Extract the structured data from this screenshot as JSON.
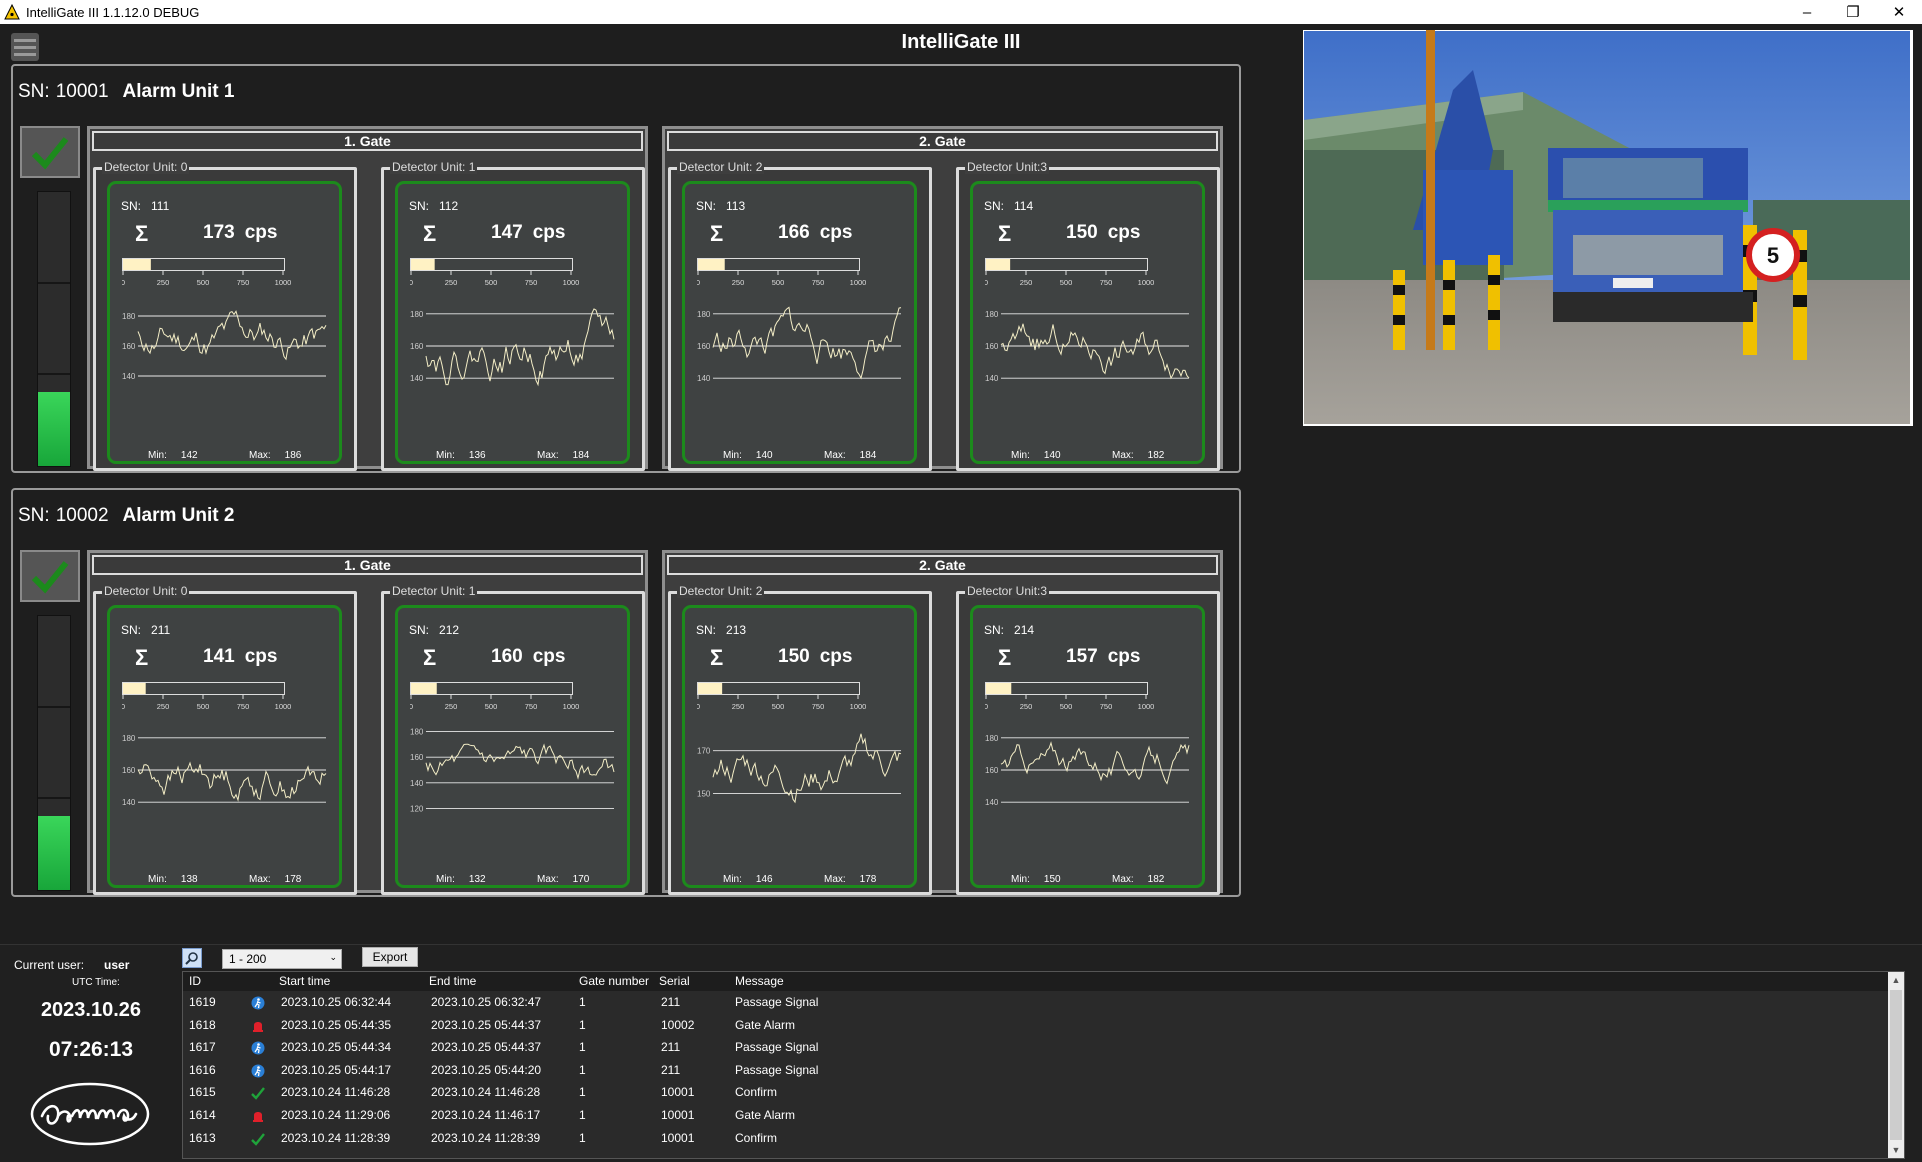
{
  "window": {
    "title": "IntelliGate III 1.1.12.0  DEBUG"
  },
  "app": {
    "title": "IntelliGate III"
  },
  "units": [
    {
      "sn_label": "SN:",
      "sn": "10001",
      "name": "Alarm Unit 1",
      "level": 0.27,
      "gates": [
        {
          "title": "1. Gate",
          "detectors": [
            {
              "label": "Detector Unit: 0",
              "sn_label": "SN:",
              "sn": "111",
              "sigma": "Σ",
              "cps": "173",
              "cps_unit": "cps",
              "fill": 0.173,
              "ticks": [
                "0",
                "250",
                "500",
                "750",
                "1000"
              ],
              "y_labels": [
                "180",
                "160",
                "140"
              ],
              "ylim": [
                130,
                190
              ],
              "min_label": "Min:",
              "min": "142",
              "max_label": "Max:",
              "max": "186",
              "seed": 11
            },
            {
              "label": "Detector Unit: 1",
              "sn_label": "SN:",
              "sn": "112",
              "sigma": "Σ",
              "cps": "147",
              "cps_unit": "cps",
              "fill": 0.147,
              "ticks": [
                "0",
                "250",
                "500",
                "750",
                "1000"
              ],
              "y_labels": [
                "180",
                "160",
                "140"
              ],
              "ylim": [
                132,
                188
              ],
              "min_label": "Min:",
              "min": "136",
              "max_label": "Max:",
              "max": "184",
              "seed": 22
            }
          ]
        },
        {
          "title": "2. Gate",
          "detectors": [
            {
              "label": "Detector Unit: 2",
              "sn_label": "SN:",
              "sn": "113",
              "sigma": "Σ",
              "cps": "166",
              "cps_unit": "cps",
              "fill": 0.166,
              "ticks": [
                "0",
                "250",
                "500",
                "750",
                "1000"
              ],
              "y_labels": [
                "180",
                "160",
                "140"
              ],
              "ylim": [
                132,
                188
              ],
              "min_label": "Min:",
              "min": "140",
              "max_label": "Max:",
              "max": "184",
              "seed": 33
            },
            {
              "label": "Detector Unit:3",
              "sn_label": "SN:",
              "sn": "114",
              "sigma": "Σ",
              "cps": "150",
              "cps_unit": "cps",
              "fill": 0.15,
              "ticks": [
                "0",
                "250",
                "500",
                "750",
                "1000"
              ],
              "y_labels": [
                "180",
                "160",
                "140"
              ],
              "ylim": [
                132,
                188
              ],
              "min_label": "Min:",
              "min": "140",
              "max_label": "Max:",
              "max": "182",
              "seed": 44
            }
          ]
        }
      ]
    },
    {
      "sn_label": "SN:",
      "sn": "10002",
      "name": "Alarm Unit 2",
      "level": 0.27,
      "gates": [
        {
          "title": "1. Gate",
          "detectors": [
            {
              "label": "Detector Unit: 0",
              "sn_label": "SN:",
              "sn": "211",
              "sigma": "Σ",
              "cps": "141",
              "cps_unit": "cps",
              "fill": 0.141,
              "ticks": [
                "0",
                "250",
                "500",
                "750",
                "1000"
              ],
              "y_labels": [
                "180",
                "160",
                "140"
              ],
              "ylim": [
                132,
                188
              ],
              "min_label": "Min:",
              "min": "138",
              "max_label": "Max:",
              "max": "178",
              "seed": 55
            },
            {
              "label": "Detector Unit: 1",
              "sn_label": "SN:",
              "sn": "212",
              "sigma": "Σ",
              "cps": "160",
              "cps_unit": "cps",
              "fill": 0.16,
              "ticks": [
                "0",
                "250",
                "500",
                "750",
                "1000"
              ],
              "y_labels": [
                "180",
                "160",
                "140",
                "120"
              ],
              "ylim": [
                115,
                185
              ],
              "min_label": "Min:",
              "min": "132",
              "max_label": "Max:",
              "max": "170",
              "seed": 66
            },
            {
              "label": "Detector Unit: 2",
              "sn_label": "SN:",
              "sn": "213",
              "sigma": "Σ",
              "cps": "150",
              "cps_unit": "cps",
              "fill": 0.15,
              "ticks": [
                "0",
                "250",
                "500",
                "750",
                "1000"
              ],
              "y_labels": [
                "170",
                "150"
              ],
              "ylim": [
                140,
                182
              ],
              "min_label": "Min:",
              "min": "146",
              "max_label": "Max:",
              "max": "178",
              "seed": 77
            }
          ]
        },
        {
          "title": "2. Gate",
          "detectors": [
            {
              "label": "Detector Unit:3",
              "sn_label": "SN:",
              "sn": "214",
              "sigma": "Σ",
              "cps": "157",
              "cps_unit": "cps",
              "fill": 0.157,
              "ticks": [
                "0",
                "250",
                "500",
                "750",
                "1000"
              ],
              "y_labels": [
                "180",
                "160",
                "140"
              ],
              "ylim": [
                132,
                188
              ],
              "min_label": "Min:",
              "min": "150",
              "max_label": "Max:",
              "max": "182",
              "seed": 88
            }
          ]
        }
      ]
    }
  ],
  "footer": {
    "current_user_label": "Current user:",
    "current_user": "user",
    "utc_label": "UTC Time:",
    "date": "2023.10.26",
    "time": "07:26:13",
    "range": "1 - 200",
    "export_label": "Export"
  },
  "log": {
    "headers": {
      "id": "ID",
      "start": "Start time",
      "end": "End time",
      "gate": "Gate number",
      "serial": "Serial",
      "message": "Message"
    },
    "rows": [
      {
        "id": "1619",
        "icon": "passage-icon",
        "start": "2023.10.25 06:32:44",
        "end": "2023.10.25 06:32:47",
        "gate": "1",
        "serial": "211",
        "message": "Passage Signal"
      },
      {
        "id": "1618",
        "icon": "alarm-bell-icon",
        "start": "2023.10.25 05:44:35",
        "end": "2023.10.25 05:44:37",
        "gate": "1",
        "serial": "10002",
        "message": "Gate Alarm"
      },
      {
        "id": "1617",
        "icon": "passage-icon",
        "start": "2023.10.25 05:44:34",
        "end": "2023.10.25 05:44:37",
        "gate": "1",
        "serial": "211",
        "message": "Passage Signal"
      },
      {
        "id": "1616",
        "icon": "passage-icon",
        "start": "2023.10.25 05:44:17",
        "end": "2023.10.25 05:44:20",
        "gate": "1",
        "serial": "211",
        "message": "Passage Signal"
      },
      {
        "id": "1615",
        "icon": "confirm-check-icon",
        "start": "2023.10.24 11:46:28",
        "end": "2023.10.24 11:46:28",
        "gate": "1",
        "serial": "10001",
        "message": "Confirm"
      },
      {
        "id": "1614",
        "icon": "alarm-bell-icon",
        "start": "2023.10.24 11:29:06",
        "end": "2023.10.24 11:46:17",
        "gate": "1",
        "serial": "10001",
        "message": "Gate Alarm"
      },
      {
        "id": "1613",
        "icon": "confirm-check-icon",
        "start": "2023.10.24 11:28:39",
        "end": "2023.10.24 11:28:39",
        "gate": "1",
        "serial": "10001",
        "message": "Confirm"
      }
    ]
  },
  "colors": {
    "ok_green": "#1c8a1c",
    "fill": "#fff2c4",
    "trace": "#f3edc6",
    "alarm": "#e0202a",
    "passage": "#2a7fd6"
  }
}
